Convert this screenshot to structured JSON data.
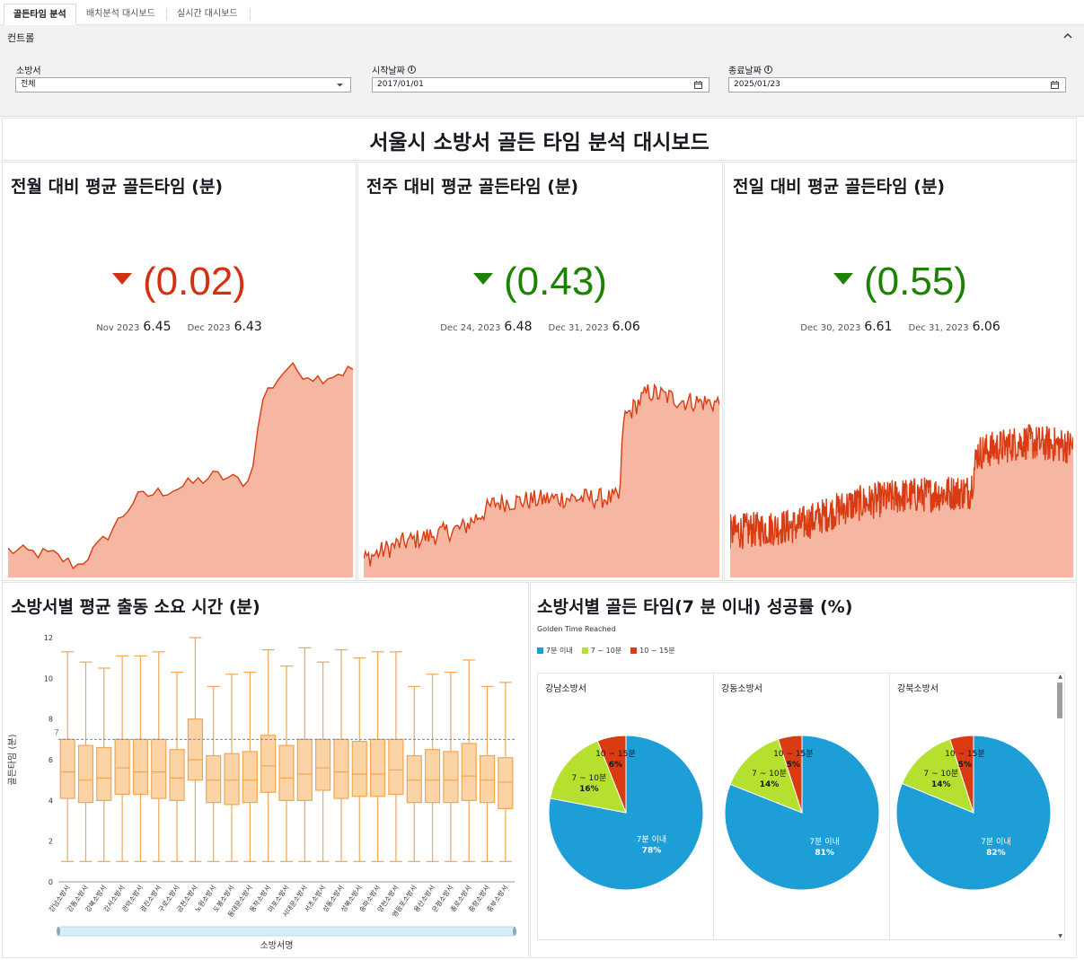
{
  "tabs": [
    {
      "label": "골든타임 분석",
      "active": true
    },
    {
      "label": "배치분석 대시보드",
      "active": false
    },
    {
      "label": "실시간 대시보드",
      "active": false
    }
  ],
  "controls": {
    "title": "컨트롤",
    "station": {
      "label": "소방서",
      "value": "전체"
    },
    "start_date": {
      "label": "시작날짜",
      "value": "2017/01/01"
    },
    "end_date": {
      "label": "종료날짜",
      "value": "2025/01/23"
    }
  },
  "dashboard_title": "서울시 소방서 골든 타임 분석 대시보드",
  "colors": {
    "down_red": "#d13212",
    "down_green": "#1d8102",
    "area_fill": "#f5b7a2",
    "line": "#d13212",
    "box_fill": "#fbd3a5",
    "box_line": "#f0a654",
    "pie_blue": "#1e9ed6",
    "pie_lime": "#b5e02f",
    "pie_red": "#d93b12"
  },
  "kpis": [
    {
      "title": "전월 대비 평균 골든타임 (분)",
      "value": "(0.02)",
      "color": "red",
      "prev_label": "Nov 2023",
      "prev_value": "6.45",
      "cur_label": "Dec 2023",
      "cur_value": "6.43"
    },
    {
      "title": "전주 대비 평균 골든타임 (분)",
      "value": "(0.43)",
      "color": "green",
      "prev_label": "Dec 24, 2023",
      "prev_value": "6.48",
      "cur_label": "Dec 31, 2023",
      "cur_value": "6.06"
    },
    {
      "title": "전일 대비 평균 골든타임 (분)",
      "value": "(0.55)",
      "color": "green",
      "prev_label": "Dec 30, 2023",
      "prev_value": "6.61",
      "cur_label": "Dec 31, 2023",
      "cur_value": "6.06"
    }
  ],
  "boxplot": {
    "title": "소방서별 평균 출동 소요 시간 (분)",
    "ylabel": "골든타임 (분)",
    "xlabel": "소방서명",
    "reference_label": "7",
    "chart_data": {
      "type": "box",
      "ylim": [
        0,
        12
      ],
      "yticks": [
        0,
        2,
        4,
        6,
        8,
        10,
        12
      ],
      "reference_line": 7,
      "categories": [
        "강남소방서",
        "강동소방서",
        "강북소방서",
        "강서소방서",
        "관악소방서",
        "광진소방서",
        "구로소방서",
        "금천소방서",
        "노원소방서",
        "도봉소방서",
        "동대문소방서",
        "동작소방서",
        "마포소방서",
        "서대문소방서",
        "서초소방서",
        "성동소방서",
        "성북소방서",
        "송파소방서",
        "양천소방서",
        "영등포소방서",
        "용산소방서",
        "은평소방서",
        "종로소방서",
        "중랑소방서",
        "중부소방서"
      ],
      "series": [
        {
          "min": 1,
          "q1": 4.1,
          "median": 5.4,
          "q3": 7.0,
          "max": 11.3
        },
        {
          "min": 1,
          "q1": 3.9,
          "median": 5.0,
          "q3": 6.7,
          "max": 10.8
        },
        {
          "min": 1,
          "q1": 4.0,
          "median": 5.1,
          "q3": 6.6,
          "max": 10.5
        },
        {
          "min": 1,
          "q1": 4.3,
          "median": 5.6,
          "q3": 7.0,
          "max": 11.1
        },
        {
          "min": 1,
          "q1": 4.3,
          "median": 5.4,
          "q3": 7.0,
          "max": 11.1
        },
        {
          "min": 1,
          "q1": 4.1,
          "median": 5.4,
          "q3": 7.0,
          "max": 11.3
        },
        {
          "min": 1,
          "q1": 4.0,
          "median": 5.1,
          "q3": 6.5,
          "max": 10.3
        },
        {
          "min": 1,
          "q1": 5.0,
          "median": 6.0,
          "q3": 8.0,
          "max": 12.0
        },
        {
          "min": 1,
          "q1": 3.9,
          "median": 5.0,
          "q3": 6.2,
          "max": 9.6
        },
        {
          "min": 1,
          "q1": 3.8,
          "median": 5.0,
          "q3": 6.3,
          "max": 10.2
        },
        {
          "min": 1,
          "q1": 3.9,
          "median": 5.0,
          "q3": 6.4,
          "max": 10.3
        },
        {
          "min": 1,
          "q1": 4.4,
          "median": 5.7,
          "q3": 7.2,
          "max": 11.4
        },
        {
          "min": 1,
          "q1": 4.0,
          "median": 5.1,
          "q3": 6.7,
          "max": 10.6
        },
        {
          "min": 1,
          "q1": 4.0,
          "median": 5.3,
          "q3": 7.0,
          "max": 11.5
        },
        {
          "min": 1,
          "q1": 4.5,
          "median": 5.6,
          "q3": 7.0,
          "max": 10.8
        },
        {
          "min": 1,
          "q1": 4.1,
          "median": 5.4,
          "q3": 7.0,
          "max": 11.4
        },
        {
          "min": 1,
          "q1": 4.2,
          "median": 5.3,
          "q3": 6.9,
          "max": 11.0
        },
        {
          "min": 1,
          "q1": 4.2,
          "median": 5.3,
          "q3": 7.0,
          "max": 11.3
        },
        {
          "min": 1,
          "q1": 4.3,
          "median": 5.5,
          "q3": 7.0,
          "max": 11.3
        },
        {
          "min": 1,
          "q1": 3.9,
          "median": 5.0,
          "q3": 6.2,
          "max": 9.6
        },
        {
          "min": 1,
          "q1": 3.9,
          "median": 5.0,
          "q3": 6.5,
          "max": 10.2
        },
        {
          "min": 1,
          "q1": 3.9,
          "median": 5.0,
          "q3": 6.4,
          "max": 10.3
        },
        {
          "min": 1,
          "q1": 4.0,
          "median": 5.2,
          "q3": 6.8,
          "max": 10.9
        },
        {
          "min": 1,
          "q1": 3.9,
          "median": 5.0,
          "q3": 6.2,
          "max": 9.6
        },
        {
          "min": 1,
          "q1": 3.6,
          "median": 4.9,
          "q3": 6.1,
          "max": 9.8
        }
      ]
    }
  },
  "pies": {
    "title": "소방서별 골든 타임(7 분 이내) 성공률 (%)",
    "legend_title": "Golden Time Reached",
    "legend": [
      {
        "label": "7분 이내",
        "color": "#1e9ed6"
      },
      {
        "label": "7 ~ 10분",
        "color": "#b5e02f"
      },
      {
        "label": "10 ~ 15분",
        "color": "#d93b12"
      }
    ],
    "chart_data": {
      "type": "pie",
      "categories": [
        "7분 이내",
        "7 ~ 10분",
        "10 ~ 15분"
      ],
      "series": [
        {
          "name": "강남소방서",
          "values": [
            78,
            16,
            6
          ]
        },
        {
          "name": "강동소방서",
          "values": [
            81,
            14,
            5
          ]
        },
        {
          "name": "강북소방서",
          "values": [
            82,
            14,
            5
          ]
        }
      ]
    }
  }
}
